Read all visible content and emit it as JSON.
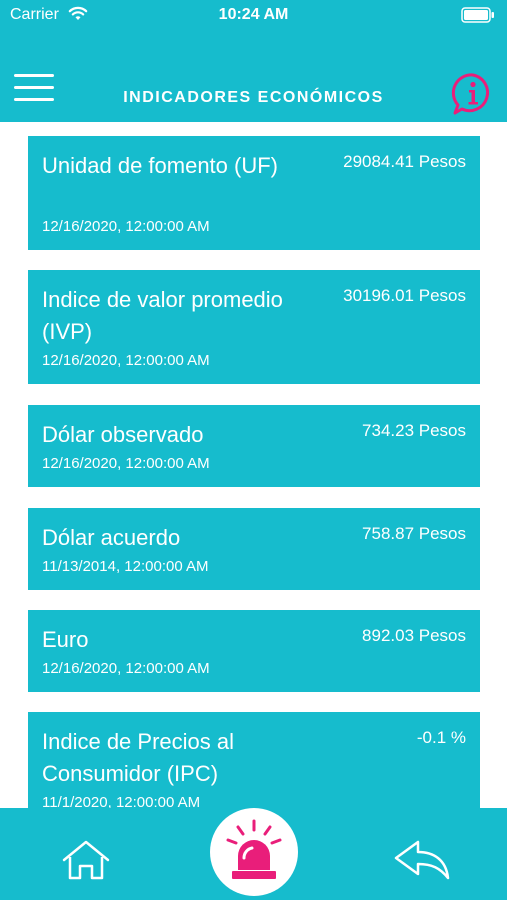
{
  "status_bar": {
    "carrier": "Carrier",
    "time": "10:24 AM"
  },
  "header": {
    "title": "INDICADORES ECONÓMICOS"
  },
  "indicators": [
    {
      "name": "Unidad de fomento (UF)",
      "value": "29084.41 Pesos",
      "date": "12/16/2020, 12:00:00 AM"
    },
    {
      "name": "Indice de valor promedio (IVP)",
      "value": "30196.01 Pesos",
      "date": "12/16/2020, 12:00:00 AM"
    },
    {
      "name": "Dólar observado",
      "value": "734.23 Pesos",
      "date": "12/16/2020, 12:00:00 AM"
    },
    {
      "name": "Dólar acuerdo",
      "value": "758.87 Pesos",
      "date": "11/13/2014, 12:00:00 AM"
    },
    {
      "name": "Euro",
      "value": "892.03 Pesos",
      "date": "12/16/2020, 12:00:00 AM"
    },
    {
      "name": "Indice de Precios al Consumidor (IPC)",
      "value": "-0.1 %",
      "date": "11/1/2020, 12:00:00 AM"
    }
  ],
  "colors": {
    "primary": "#16bccd",
    "accent": "#e91e7a",
    "text": "#ffffff"
  },
  "icons": {
    "menu": "hamburger-menu-icon",
    "info": "info-chat-icon",
    "home": "home-icon",
    "alarm": "siren-icon",
    "back": "back-arrow-icon"
  }
}
